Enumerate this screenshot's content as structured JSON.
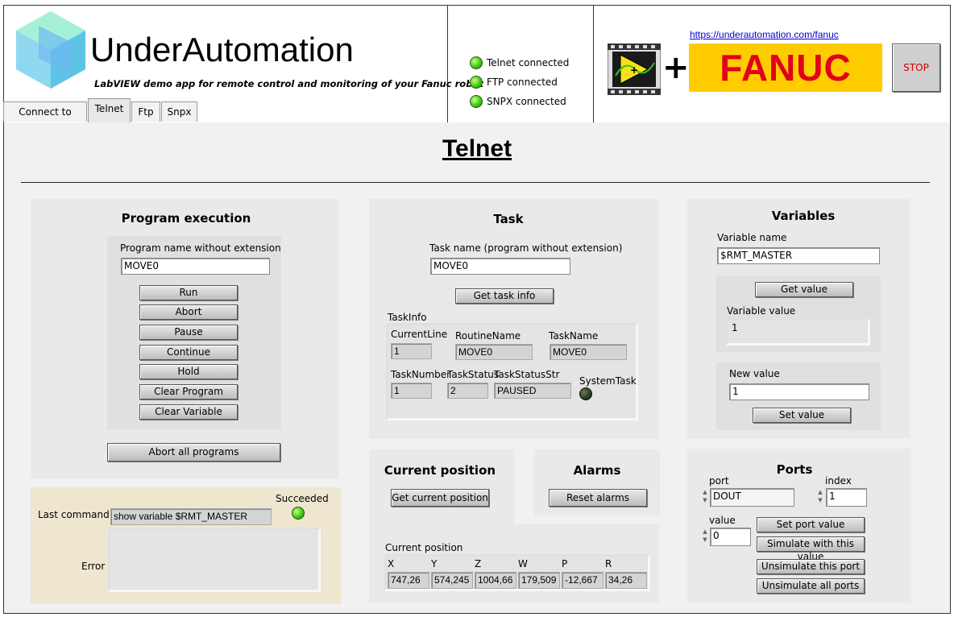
{
  "header": {
    "brand": "UnderAutomation",
    "subtitle": "LabVIEW demo app for remote control and monitoring of your Fanuc robot",
    "status": [
      {
        "label": "Telnet connected",
        "on": true
      },
      {
        "label": "FTP connected",
        "on": true
      },
      {
        "label": "SNPX connected",
        "on": true
      }
    ],
    "link": "https://underautomation.com/fanuc",
    "fanuc_logo": "FANUC",
    "stop_label": "STOP"
  },
  "tabs": [
    "Connect to robot",
    "Telnet",
    "Ftp",
    "Snpx"
  ],
  "active_tab": "Telnet",
  "page_title": "Telnet",
  "program_execution": {
    "title": "Program execution",
    "name_label": "Program name without extension",
    "name_value": "MOVE0",
    "buttons": [
      "Run",
      "Abort",
      "Pause",
      "Continue",
      "Hold",
      "Clear Program",
      "Clear Variable"
    ],
    "abort_all": "Abort all programs"
  },
  "last_command": {
    "label": "Last command :",
    "value": "show variable $RMT_MASTER",
    "succeeded_label": "Succeeded",
    "succeeded": true,
    "error_label": "Error :",
    "error_value": ""
  },
  "task": {
    "title": "Task",
    "name_label": "Task name (program without extension)",
    "name_value": "MOVE0",
    "get_button": "Get task info",
    "info_label": "TaskInfo",
    "current_line_label": "CurrentLine",
    "current_line": "1",
    "routine_name_label": "RoutineName",
    "routine_name": "MOVE0",
    "task_name_label": "TaskName",
    "task_name": "MOVE0",
    "task_number_label": "TaskNumber",
    "task_number": "1",
    "task_status_label": "TaskStatus",
    "task_status": "2",
    "task_status_str_label": "TaskStatusStr",
    "task_status_str": "PAUSED",
    "system_task_label": "SystemTask",
    "system_task": false
  },
  "current_position": {
    "title": "Current position",
    "get_button": "Get current position",
    "values_label": "Current position",
    "columns": [
      "X",
      "Y",
      "Z",
      "W",
      "P",
      "R"
    ],
    "values": [
      "747,26",
      "574,245",
      "1004,66",
      "179,509",
      "-12,667",
      "34,26"
    ]
  },
  "alarms": {
    "title": "Alarms",
    "reset_button": "Reset alarms"
  },
  "variables": {
    "title": "Variables",
    "name_label": "Variable name",
    "name_value": "$RMT_MASTER",
    "get_button": "Get value",
    "value_label": "Variable value",
    "value": "1",
    "new_value_label": "New value",
    "new_value": "1",
    "set_button": "Set value"
  },
  "ports": {
    "title": "Ports",
    "port_label": "port",
    "port_value": "DOUT",
    "index_label": "index",
    "index_value": "1",
    "value_label": "value",
    "value": "0",
    "set_button": "Set port value",
    "simulate_button": "Simulate with this value",
    "unsimulate_button": "Unsimulate this port",
    "unsimulate_all_button": "Unsimulate all ports"
  },
  "colors": {
    "led_on": "#3dcc14",
    "fanuc_yellow": "#ffcc00",
    "fanuc_red": "#e0001b",
    "stop_bg": "#d0d0d0",
    "panel_bg": "#e9e9e9",
    "cmd_bg": "#efe6cf"
  }
}
